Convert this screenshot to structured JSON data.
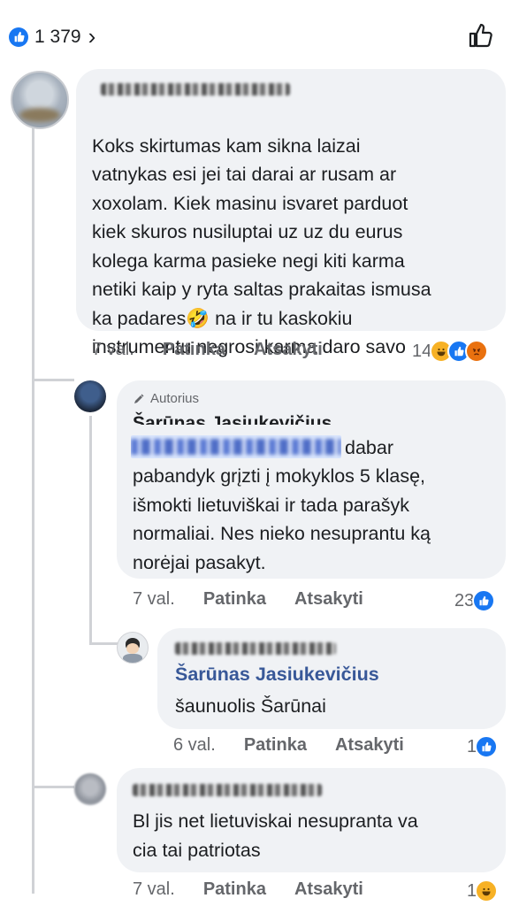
{
  "header": {
    "reaction_count": "1 379",
    "chevron": "›",
    "like_icon": "thumbs-up-outline-icon"
  },
  "comments": [
    {
      "text": "Koks skirtumas kam sikna laizai\nvatnykas esi jei tai darai ar rusam ar\nxoxolam. Kiek masinu isvaret parduot\nkiek skuros nusiluptai uz uz du eurus\nkolega karma pasieke negi kiti karma\nnetiki kaip y ryta saltas prakaitas ismusa\nka padares",
      "emoji": "🤣",
      "text_tail": " na ir tu kaskokiu\ninstrumentu negrosi karma daro savo",
      "time": "7 val.",
      "like_label": "Patinka",
      "reply_label": "Atsakyti",
      "reaction_count": "14",
      "reaction_icons": [
        "haha-icon",
        "like-icon",
        "angry-icon"
      ]
    },
    {
      "author_tag": "Autorius",
      "author_name": "Šarūnas Jasiukevičius",
      "text_head": "dabar",
      "text": "pabandyk grįzti į mokyklos 5 klasę,\nišmokti lietuviškai ir tada parašyk\nnormaliai. Nes nieko nesuprantu ką\nnorėjai pasakyt.",
      "time": "7 val.",
      "like_label": "Patinka",
      "reply_label": "Atsakyti",
      "reaction_count": "23",
      "reaction_icons": [
        "like-icon"
      ]
    },
    {
      "mention": "Šarūnas Jasiukevičius",
      "text": "šaunuolis Šarūnai",
      "time": "6 val.",
      "like_label": "Patinka",
      "reply_label": "Atsakyti",
      "reaction_count": "1",
      "reaction_icons": [
        "like-icon"
      ]
    },
    {
      "text": "Bl jis net lietuviskai nesupranta va\ncia tai patriotas",
      "time": "7 val.",
      "like_label": "Patinka",
      "reply_label": "Atsakyti",
      "reaction_count": "1",
      "reaction_icons": [
        "haha-icon"
      ]
    }
  ]
}
